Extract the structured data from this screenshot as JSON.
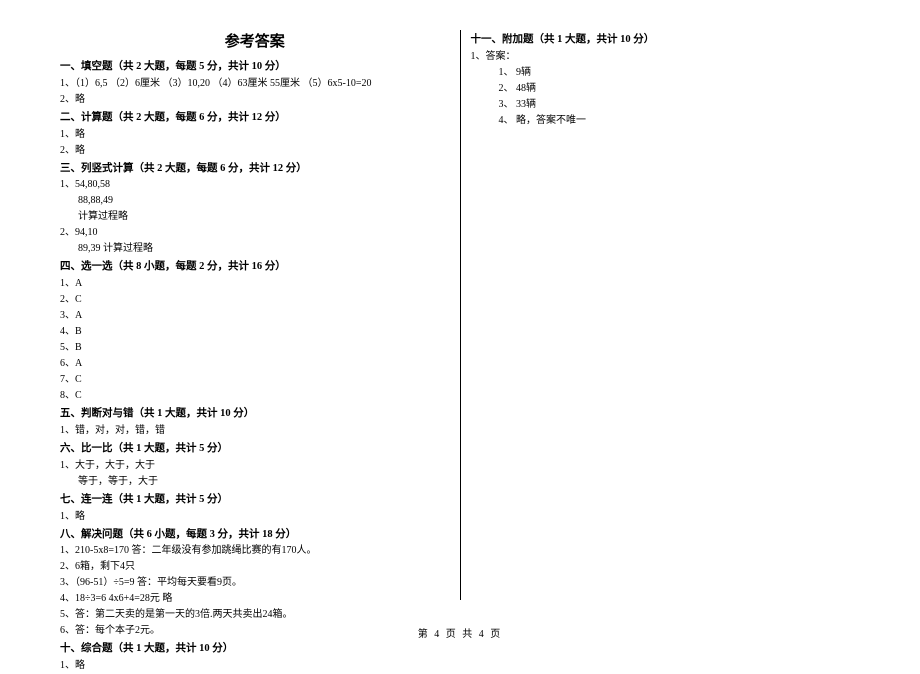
{
  "title": "参考答案",
  "footer": "第 4 页 共 4 页",
  "left": {
    "s1": {
      "head": "一、填空题（共 2 大题，每题 5 分，共计 10 分）",
      "i1": "1、（1）6,5 （2）6厘米 （3）10,20 （4）63厘米 55厘米 （5）6x5-10=20",
      "i2": "2、略"
    },
    "s2": {
      "head": "二、计算题（共 2 大题，每题 6 分，共计 12 分）",
      "i1": "1、略",
      "i2": "2、略"
    },
    "s3": {
      "head": "三、列竖式计算（共 2 大题，每题 6 分，共计 12 分）",
      "i1": "1、54,80,58",
      "i1a": "88,88,49",
      "i1b": "计算过程略",
      "i2": "2、94,10",
      "i2a": "89,39   计算过程略"
    },
    "s4": {
      "head": "四、选一选（共 8 小题，每题 2 分，共计 16 分）",
      "a1": "1、A",
      "a2": "2、C",
      "a3": "3、A",
      "a4": "4、B",
      "a5": "5、B",
      "a6": "6、A",
      "a7": "7、C",
      "a8": "8、C"
    },
    "s5": {
      "head": "五、判断对与错（共 1 大题，共计 10 分）",
      "i1": "1、错，对，对，错，错"
    },
    "s6": {
      "head": "六、比一比（共 1 大题，共计 5 分）",
      "i1": "1、大于，大于，大于",
      "i1a": "等于，等于，大于"
    },
    "s7": {
      "head": "七、连一连（共 1 大题，共计 5 分）",
      "i1": "1、略"
    },
    "s8": {
      "head": "八、解决问题（共 6 小题，每题 3 分，共计 18 分）",
      "i1": "1、210-5x8=170    答：二年级没有参加跳绳比赛的有170人。",
      "i2": "2、6箱，剩下4只",
      "i3": "3、（96-51）÷5=9   答：平均每天要看9页。",
      "i4": "4、18÷3=6     4x6+4=28元     略",
      "i5": "5、答：第二天卖的是第一天的3倍.两天共卖出24箱。",
      "i6": "6、答：每个本子2元。"
    },
    "s10": {
      "head": "十、综合题（共 1 大题，共计 10 分）",
      "i1": "1、略"
    }
  },
  "right": {
    "s11": {
      "head": "十一、附加题（共 1 大题，共计 10 分）",
      "i1": "1、答案：",
      "a1": "1、 9辆",
      "a2": "2、 48辆",
      "a3": "3、 33辆",
      "a4": "4、 略，答案不唯一"
    }
  }
}
